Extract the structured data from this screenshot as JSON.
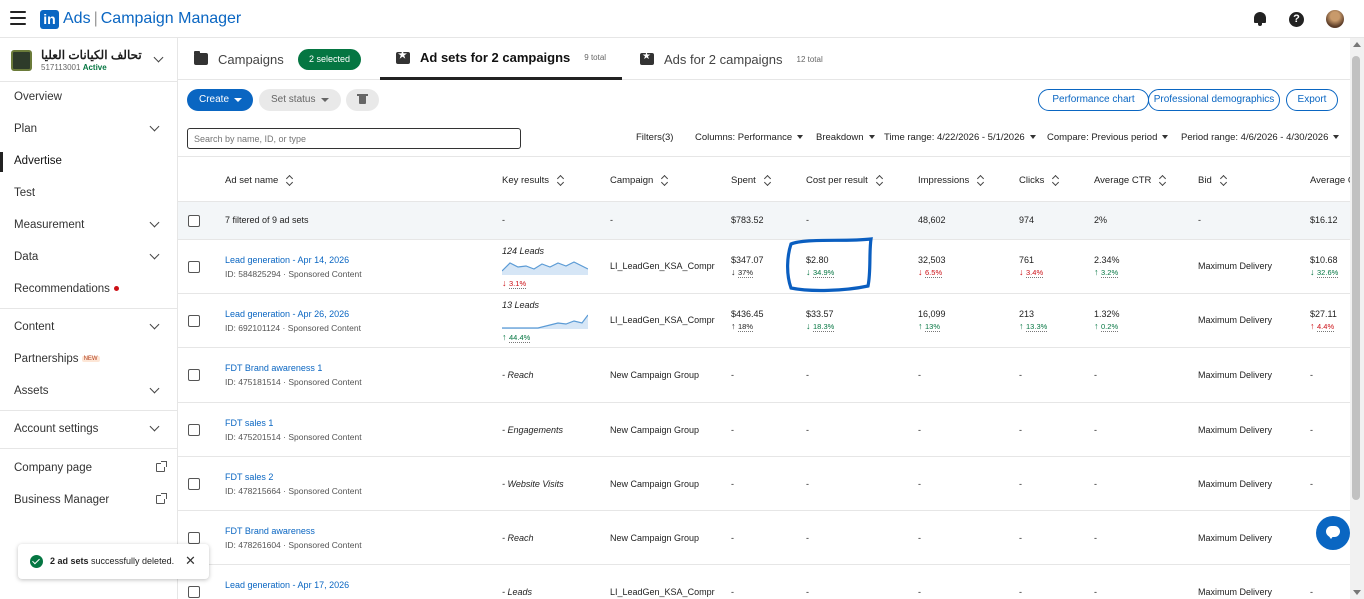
{
  "header": {
    "logo_text": "in",
    "app_name": "Ads",
    "separator": "|",
    "product": "Campaign Manager"
  },
  "account": {
    "name": "تحالف الكيانات العليا",
    "id": "517113001",
    "status": "Active"
  },
  "nav": {
    "overview": "Overview",
    "plan": "Plan",
    "advertise": "Advertise",
    "test": "Test",
    "measurement": "Measurement",
    "data": "Data",
    "recommendations": "Recommendations",
    "content": "Content",
    "partnerships": "Partnerships",
    "new_badge": "NEW",
    "assets": "Assets",
    "account_settings": "Account settings",
    "company_page": "Company page",
    "business_manager": "Business Manager"
  },
  "tabs": {
    "campaigns": "Campaigns",
    "selected": "2 selected",
    "adsets": "Ad sets for 2 campaigns",
    "adsets_count": "9 total",
    "ads": "Ads for 2 campaigns",
    "ads_count": "12 total"
  },
  "toolbar": {
    "create": "Create",
    "set_status": "Set status",
    "performance_chart": "Performance chart",
    "professional_demographics": "Professional demographics",
    "export": "Export"
  },
  "filters": {
    "search_placeholder": "Search by name, ID, or type",
    "filters": "Filters(3)",
    "columns": "Columns:  Performance",
    "breakdown": "Breakdown",
    "time_range": "Time range: 4/22/2026 - 5/1/2026",
    "compare": "Compare: Previous period",
    "period_range": "Period range: 4/6/2026 - 4/30/2026"
  },
  "columns": {
    "name": "Ad set name",
    "key_results": "Key results",
    "campaign": "Campaign",
    "spent": "Spent",
    "cpr": "Cost per result",
    "impressions": "Impressions",
    "clicks": "Clicks",
    "ctr": "Average CTR",
    "bid": "Bid",
    "avg": "Average C"
  },
  "summary": {
    "label": "7 filtered of 9 ad sets",
    "key": "-",
    "campaign": "-",
    "spent": "$783.52",
    "cpr": "-",
    "impressions": "48,602",
    "clicks": "974",
    "ctr": "2%",
    "bid": "-",
    "avg": "$16.12"
  },
  "rows": [
    {
      "name": "Lead generation - Apr 14, 2026",
      "id": "ID: 584825294 · Sponsored Content",
      "key": "124 Leads",
      "key_delta": "3.1%",
      "campaign": "LI_LeadGen_KSA_Compr",
      "spent": "$347.07",
      "spent_delta": "37%",
      "cpr": "$2.80",
      "cpr_delta": "34.9%",
      "impr": "32,503",
      "impr_delta": "6.5%",
      "clicks": "761",
      "clicks_delta": "3.4%",
      "ctr": "2.34%",
      "ctr_delta": "3.2%",
      "bid": "Maximum Delivery",
      "avg": "$10.68",
      "avg_delta": "32.6%"
    },
    {
      "name": "Lead generation - Apr 26, 2026",
      "id": "ID: 692101124 · Sponsored Content",
      "key": "13 Leads",
      "key_delta": "44.4%",
      "campaign": "LI_LeadGen_KSA_Compr",
      "spent": "$436.45",
      "spent_delta": "18%",
      "cpr": "$33.57",
      "cpr_delta": "18.3%",
      "impr": "16,099",
      "impr_delta": "13%",
      "clicks": "213",
      "clicks_delta": "13.3%",
      "ctr": "1.32%",
      "ctr_delta": "0.2%",
      "bid": "Maximum Delivery",
      "avg": "$27.11",
      "avg_delta": "4.4%"
    },
    {
      "name": "FDT Brand awareness 1",
      "id": "ID: 475181514 · Sponsored Content",
      "key": "- Reach",
      "campaign": "New Campaign Group",
      "dash": "-",
      "bid": "Maximum Delivery"
    },
    {
      "name": "FDT sales 1",
      "id": "ID: 475201514 · Sponsored Content",
      "key": "- Engagements",
      "campaign": "New Campaign Group",
      "dash": "-",
      "bid": "Maximum Delivery"
    },
    {
      "name": "FDT sales 2",
      "id": "ID: 478215664 · Sponsored Content",
      "key": "- Website Visits",
      "campaign": "New Campaign Group",
      "dash": "-",
      "bid": "Maximum Delivery"
    },
    {
      "name": "FDT Brand awareness",
      "id": "ID: 478261604 · Sponsored Content",
      "key": "- Reach",
      "campaign": "New Campaign Group",
      "dash": "-",
      "bid": "Maximum Delivery"
    },
    {
      "name": "Lead generation - Apr 17, 2026",
      "key": "- Leads",
      "campaign": "LI_LeadGen_KSA_Compr",
      "dash": "-",
      "bid": "Maximum Delivery"
    }
  ],
  "toast": {
    "bold": "2 ad sets",
    "text": " successfully deleted."
  },
  "colors": {
    "accent": "#0a66c2",
    "positive": "#057642",
    "negative": "#cc1016",
    "annotation": "#0a5ec0"
  }
}
